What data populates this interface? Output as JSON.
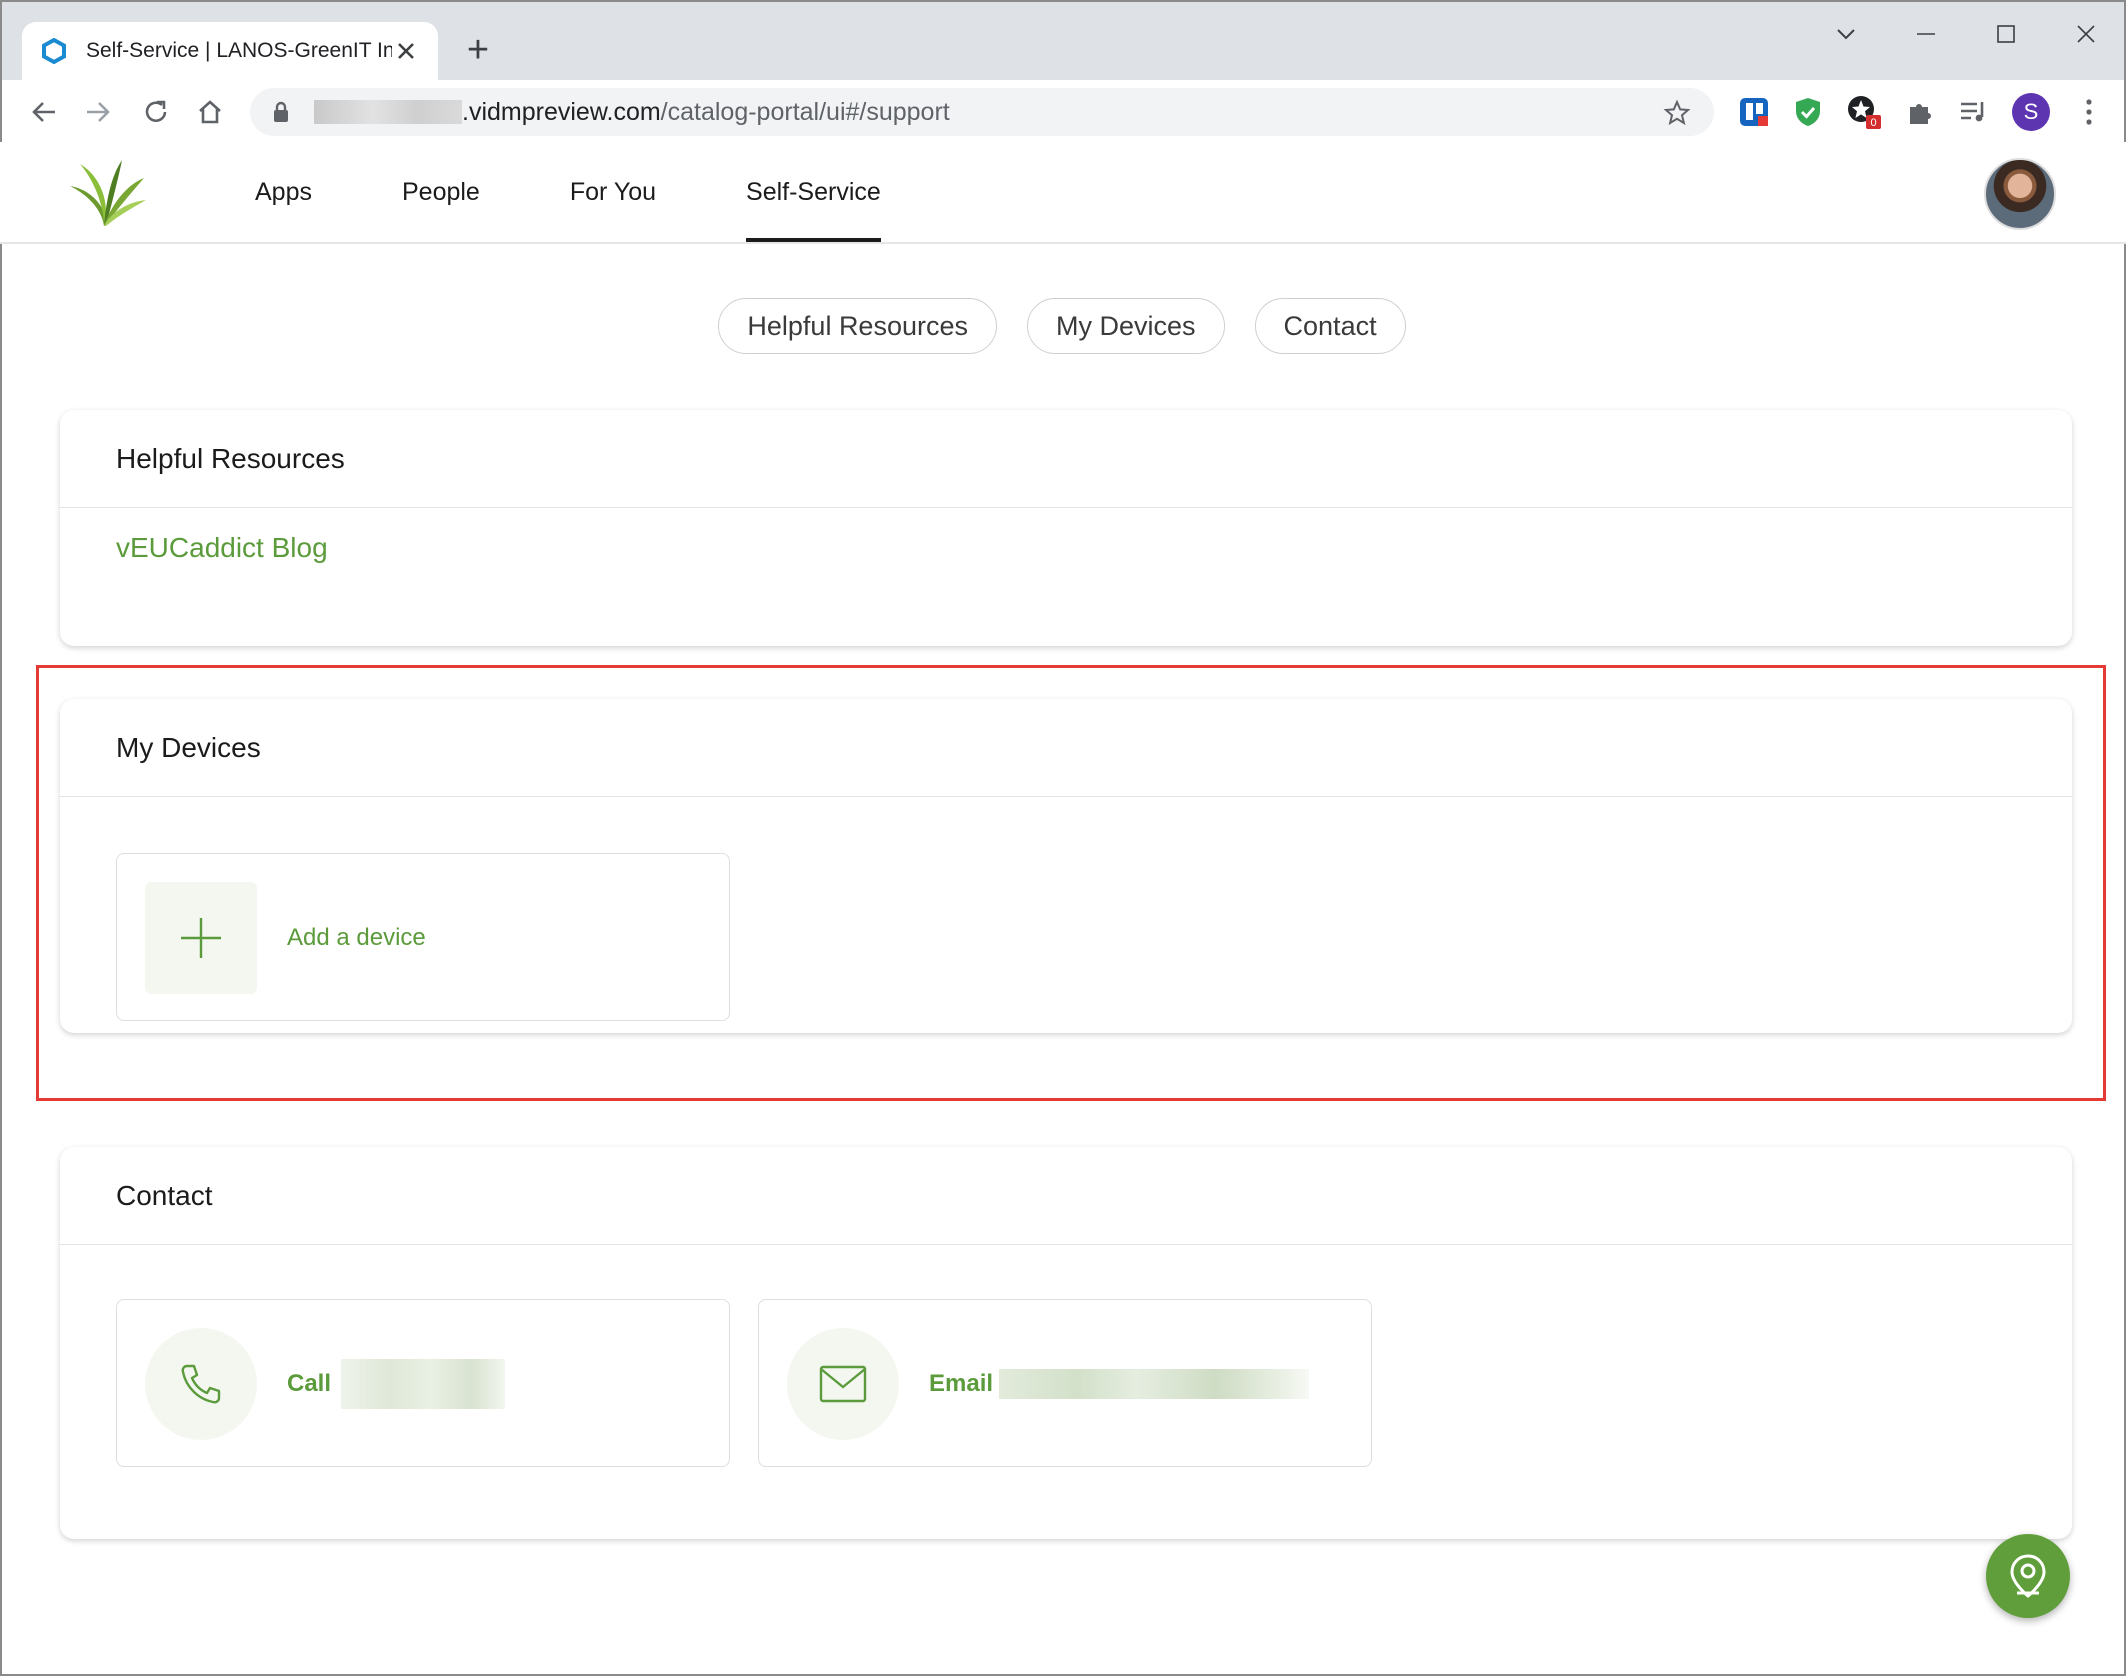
{
  "browser": {
    "tab_title": "Self-Service | LANOS-GreenIT Intelligence",
    "new_tab_symbol": "+",
    "url_host_suffix": ".vidmpreview.com",
    "url_path": "/catalog-portal/ui#/support",
    "profile_initial": "S",
    "extension_badge": "0"
  },
  "header": {
    "nav": [
      {
        "label": "Apps"
      },
      {
        "label": "People"
      },
      {
        "label": "For You"
      },
      {
        "label": "Self-Service"
      }
    ]
  },
  "section_nav": {
    "pills": [
      {
        "label": "Helpful Resources"
      },
      {
        "label": "My Devices"
      },
      {
        "label": "Contact"
      }
    ]
  },
  "helpful_resources": {
    "title": "Helpful Resources",
    "link": "vEUCaddict Blog"
  },
  "my_devices": {
    "title": "My Devices",
    "add_label": "Add a device"
  },
  "contact": {
    "title": "Contact",
    "call_label": "Call",
    "email_label": "Email"
  },
  "colors": {
    "accent_green": "#5b9b3b",
    "fab_green": "#5f9e3a",
    "highlight_red": "#e53935"
  }
}
